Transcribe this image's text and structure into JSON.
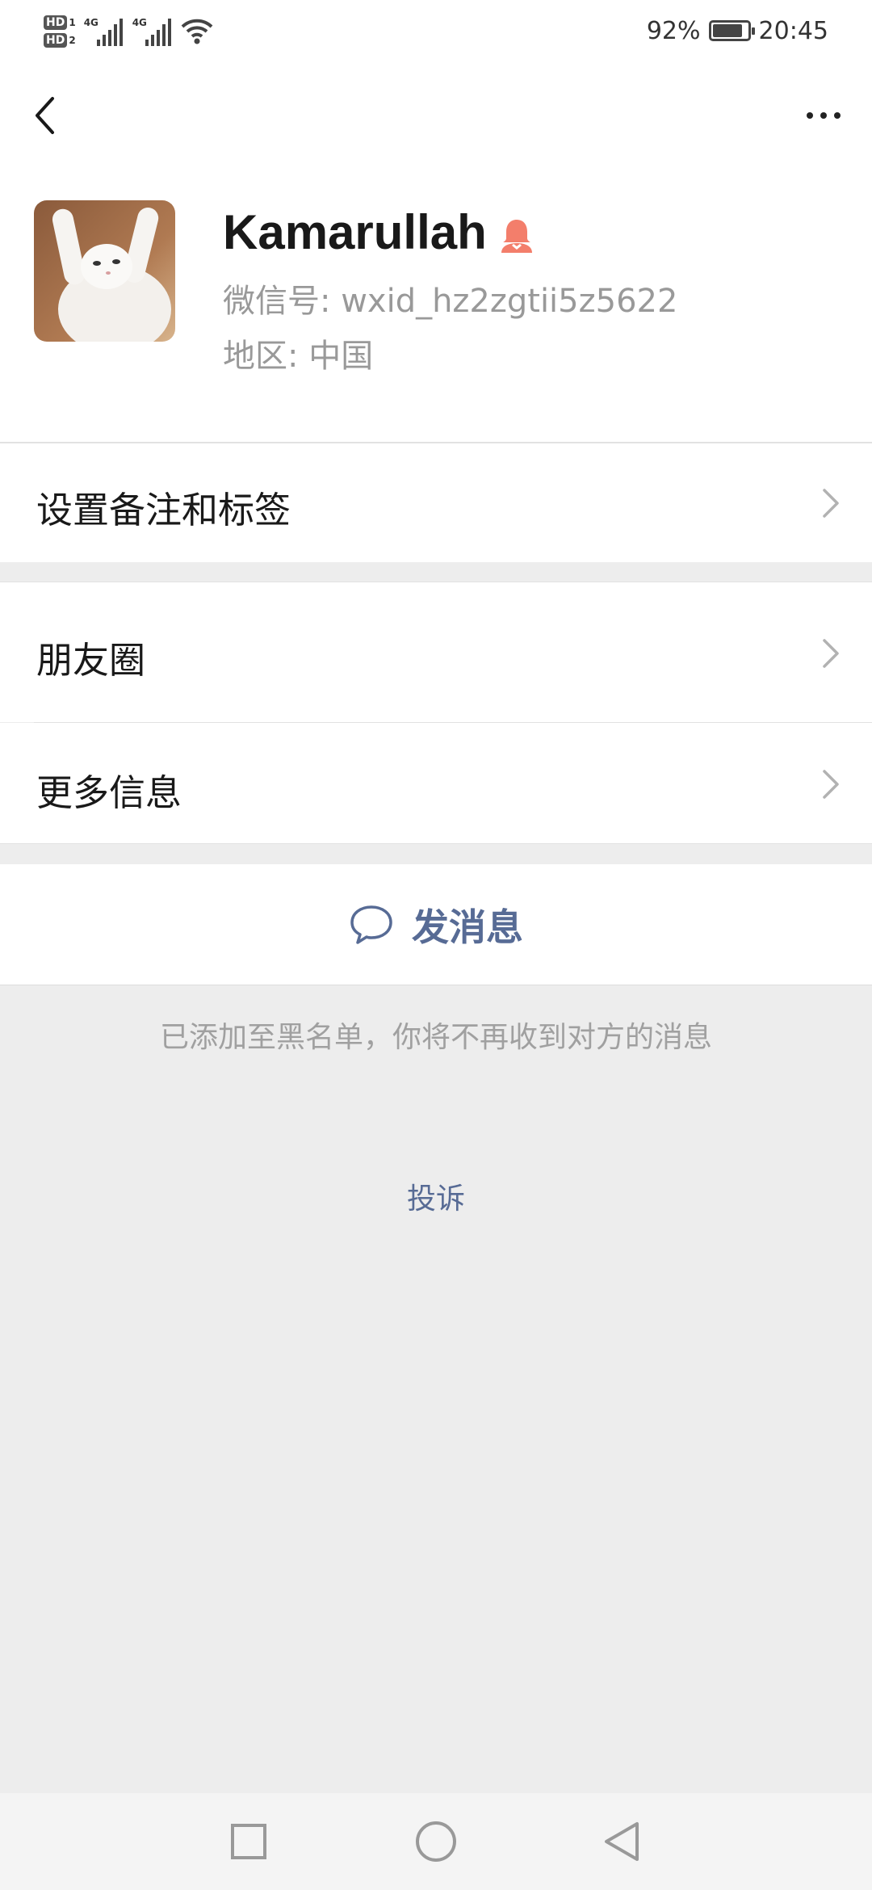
{
  "status_bar": {
    "hd1": "HD",
    "hd1_num": "1",
    "hd2": "HD",
    "hd2_num": "2",
    "net1": "4G",
    "net2": "4G",
    "battery_pct": "92%",
    "time": "20:45"
  },
  "profile": {
    "name": "Kamarullah",
    "wechat_id": "微信号: wxid_hz2zgtii5z5622",
    "region": "地区: 中国",
    "gender_icon": "female-icon",
    "gender_color": "#f37e6b"
  },
  "menu": {
    "remark": "设置备注和标签",
    "moments": "朋友圈",
    "more_info": "更多信息"
  },
  "actions": {
    "send_message": "发消息"
  },
  "notice": {
    "blacklist": "已添加至黑名单，你将不再收到对方的消息",
    "complain": "投诉"
  },
  "colors": {
    "link": "#576b95",
    "background": "#ededed"
  }
}
